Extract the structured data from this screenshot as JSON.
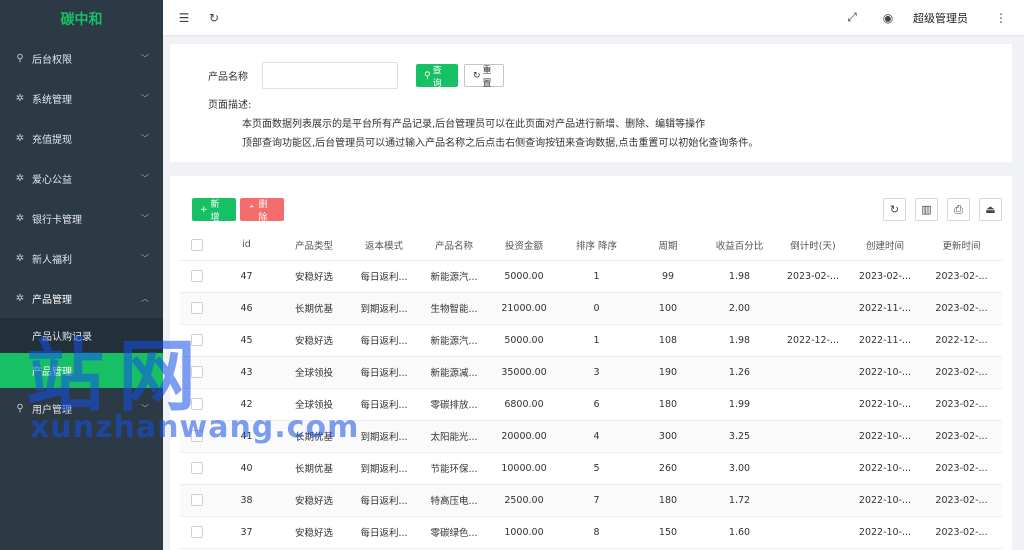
{
  "app": {
    "logo": "碳中和"
  },
  "sidebar": {
    "items": [
      {
        "icon": "user-icon",
        "label": "后台权限"
      },
      {
        "icon": "gear-icon",
        "label": "系统管理"
      },
      {
        "icon": "gear-icon",
        "label": "充值提现"
      },
      {
        "icon": "gear-icon",
        "label": "爱心公益"
      },
      {
        "icon": "gear-icon",
        "label": "银行卡管理"
      },
      {
        "icon": "gear-icon",
        "label": "新人福利"
      },
      {
        "icon": "gear-icon",
        "label": "产品管理"
      }
    ],
    "sub_items": [
      {
        "label": "产品认购记录"
      },
      {
        "label": "产品管理"
      }
    ],
    "last_item": {
      "icon": "user-icon",
      "label": "用户管理"
    }
  },
  "header": {
    "admin": "超级管理员"
  },
  "search": {
    "label": "产品名称",
    "value": "",
    "query_label": "查询",
    "reset_label": "重置",
    "desc_title": "页面描述:",
    "desc_line1": "本页面数据列表展示的是平台所有产品记录,后台管理员可以在此页面对产品进行新增、删除、编辑等操作",
    "desc_line2": "顶部查询功能区,后台管理员可以通过输入产品名称之后点击右侧查询按钮来查询数据,点击重置可以初始化查询条件。"
  },
  "toolbar": {
    "add_label": "新增",
    "delete_label": "删除"
  },
  "table": {
    "headers": [
      "id",
      "产品类型",
      "返本模式",
      "产品名称",
      "投资金额",
      "排序 降序",
      "周期",
      "收益百分比",
      "倒计时(天)",
      "创建时间",
      "更新时间"
    ],
    "rows": [
      [
        "47",
        "安稳好选",
        "每日返利...",
        "新能源汽...",
        "5000.00",
        "1",
        "99",
        "1.98",
        "2023-02-...",
        "2023-02-...",
        "2023-02-..."
      ],
      [
        "46",
        "长期优基",
        "到期返利...",
        "生物智能...",
        "21000.00",
        "0",
        "100",
        "2.00",
        "",
        "2022-11-...",
        "2023-02-..."
      ],
      [
        "45",
        "安稳好选",
        "每日返利...",
        "新能源汽...",
        "5000.00",
        "1",
        "108",
        "1.98",
        "2022-12-...",
        "2022-11-...",
        "2022-12-..."
      ],
      [
        "43",
        "全球领投",
        "每日返利...",
        "新能源减...",
        "35000.00",
        "3",
        "190",
        "1.26",
        "",
        "2022-10-...",
        "2023-02-..."
      ],
      [
        "42",
        "全球领投",
        "每日返利...",
        "零碳排放...",
        "6800.00",
        "6",
        "180",
        "1.99",
        "",
        "2022-10-...",
        "2023-02-..."
      ],
      [
        "41",
        "长期优基",
        "到期返利...",
        "太阳能光...",
        "20000.00",
        "4",
        "300",
        "3.25",
        "",
        "2022-10-...",
        "2023-02-..."
      ],
      [
        "40",
        "长期优基",
        "到期返利...",
        "节能环保...",
        "10000.00",
        "5",
        "260",
        "3.00",
        "",
        "2022-10-...",
        "2023-02-..."
      ],
      [
        "38",
        "安稳好选",
        "每日返利...",
        "特高压电...",
        "2500.00",
        "7",
        "180",
        "1.72",
        "",
        "2022-10-...",
        "2023-02-..."
      ],
      [
        "37",
        "安稳好选",
        "每日返利...",
        "零碳绿色...",
        "1000.00",
        "8",
        "150",
        "1.60",
        "",
        "2022-10-...",
        "2023-02-..."
      ]
    ]
  },
  "watermark": {
    "big": "站网",
    "small": "xunzhanwang.com"
  }
}
